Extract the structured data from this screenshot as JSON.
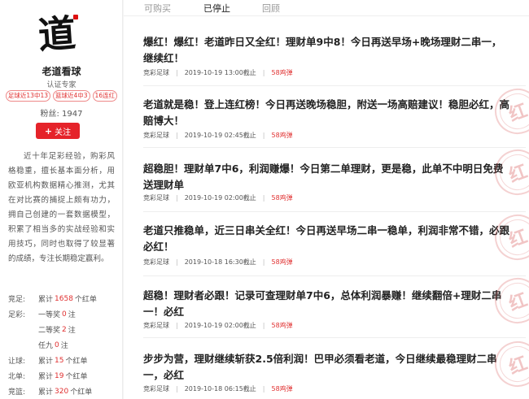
{
  "profile": {
    "avatar_char": "道",
    "name": "老道看球",
    "certification": "认证专家",
    "badges": [
      "足球近13中13",
      "篮球近4中3",
      "16连红"
    ],
    "fans_label": "粉丝:",
    "fans_count": "1947",
    "follow_label": "关注",
    "bio": "近十年足彩经验，购彩风格稳重，擅长基本面分析，用欧亚机构数据精心推测，尤其在对比赛的捕捉上颇有功力，拥自己创建的一套数据模型，积累了相当多的实战经验和实用技巧，同时也取得了较显著的成绩，专注长期稳定赢利。"
  },
  "stats": [
    {
      "label": "竞足:",
      "prefix": "累计",
      "value": "1658",
      "suffix": "个红单"
    },
    {
      "label": "足彩:",
      "prefix": "一等奖",
      "value": "0",
      "suffix": "注"
    },
    {
      "label": "",
      "prefix": "二等奖",
      "value": "2",
      "suffix": "注"
    },
    {
      "label": "",
      "prefix": "任九",
      "value": "0",
      "suffix": "注"
    },
    {
      "label": "让球:",
      "prefix": "累计",
      "value": "15",
      "suffix": "个红单"
    },
    {
      "label": "北单:",
      "prefix": "累计",
      "value": "19",
      "suffix": "个红单"
    },
    {
      "label": "竞篮:",
      "prefix": "累计",
      "value": "320",
      "suffix": "个红单"
    }
  ],
  "tabs": [
    {
      "label": "可购买",
      "active": false
    },
    {
      "label": "已停止",
      "active": true
    },
    {
      "label": "回顾",
      "active": false
    }
  ],
  "articles": [
    {
      "title": "爆红！爆红！老道昨日又全红！理财单9中8！今日再送早场+晚场理财二串一，继续红！",
      "category": "竞彩足球",
      "time": "2019-10-19 13:00截止",
      "price": "58鸡弹",
      "stamp": false
    },
    {
      "title": "老道就是稳！登上连红榜！今日再送晚场稳胆，附送一场高赔建议！稳胆必红，高赔博大！",
      "category": "竞彩足球",
      "time": "2019-10-19 02:45截止",
      "price": "58鸡弹",
      "stamp": true
    },
    {
      "title": "超稳胆！理财单7中6，利润赚爆！今日第二单理财，更是稳，此单不中明日免费送理财单",
      "category": "竞彩足球",
      "time": "2019-10-19 02:00截止",
      "price": "58鸡弹",
      "stamp": true
    },
    {
      "title": "老道只推稳单，近三日串关全红！今日再送早场二串一稳单，利润非常不错，必跟必红！",
      "category": "竞彩足球",
      "time": "2019-10-18 16:30截止",
      "price": "58鸡弹",
      "stamp": true
    },
    {
      "title": "超稳！理财者必跟！记录可查理财单7中6，总体利润暴赚！继续翻倍+理财二串一！必红",
      "category": "竞彩足球",
      "time": "2019-10-19 02:00截止",
      "price": "58鸡弹",
      "stamp": true
    },
    {
      "title": "步步为营，理财继续斩获2.5倍利润！巴甲必须看老道，今日继续最稳理财二串一，必红",
      "category": "竞彩足球",
      "time": "2019-10-18 06:15截止",
      "price": "58鸡弹",
      "stamp": true
    }
  ],
  "stamp_char": "红"
}
